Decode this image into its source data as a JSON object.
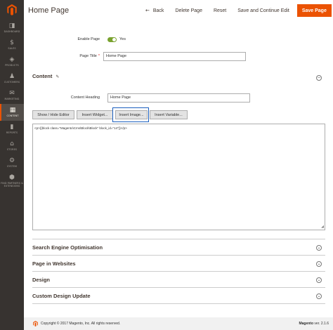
{
  "sidebar": {
    "items": [
      {
        "icon": "◨",
        "label": "DASHBOARD"
      },
      {
        "icon": "$",
        "label": "SALES"
      },
      {
        "icon": "◈",
        "label": "PRODUCTS"
      },
      {
        "icon": "♟",
        "label": "CUSTOMERS"
      },
      {
        "icon": "✉",
        "label": "MARKETING"
      },
      {
        "icon": "▦",
        "label": "CONTENT"
      },
      {
        "icon": "▮",
        "label": "REPORTS"
      },
      {
        "icon": "⌂",
        "label": "STORES"
      },
      {
        "icon": "⚙",
        "label": "SYSTEM"
      },
      {
        "icon": "⬢",
        "label": "FIND PARTNERS & EXTENSIONS"
      }
    ]
  },
  "header": {
    "title": "Home Page",
    "back_label": "Back",
    "delete_label": "Delete Page",
    "reset_label": "Reset",
    "save_continue_label": "Save and Continue Edit",
    "save_label": "Save Page"
  },
  "form": {
    "enable_label": "Enable Page",
    "enable_value": "Yes",
    "page_title_label": "Page Title",
    "page_title_value": "Home Page"
  },
  "content": {
    "section_title": "Content",
    "heading_label": "Content Heading",
    "heading_value": "Home Page",
    "buttons": {
      "show_hide": "Show / Hide Editor",
      "insert_widget": "Insert Widget...",
      "insert_image": "Insert Image...",
      "insert_variable": "Insert Variable..."
    },
    "editor_text": "<p>{{block class=\"Magento\\Cms\\Block\\Block\" block_id=\"14\"}}</p>"
  },
  "sections": [
    "Search Engine Optimisation",
    "Page in Websites",
    "Design",
    "Custom Design Update"
  ],
  "footer": {
    "copyright": "Copyright © 2017 Magento, Inc. All rights reserved.",
    "version_label": "Magento",
    "version_value": "ver. 2.1.6"
  },
  "colors": {
    "accent": "#eb5202",
    "sidebar_bg": "#373330",
    "toggle_on": "#79a22e",
    "highlight": "#1b5fbf"
  }
}
